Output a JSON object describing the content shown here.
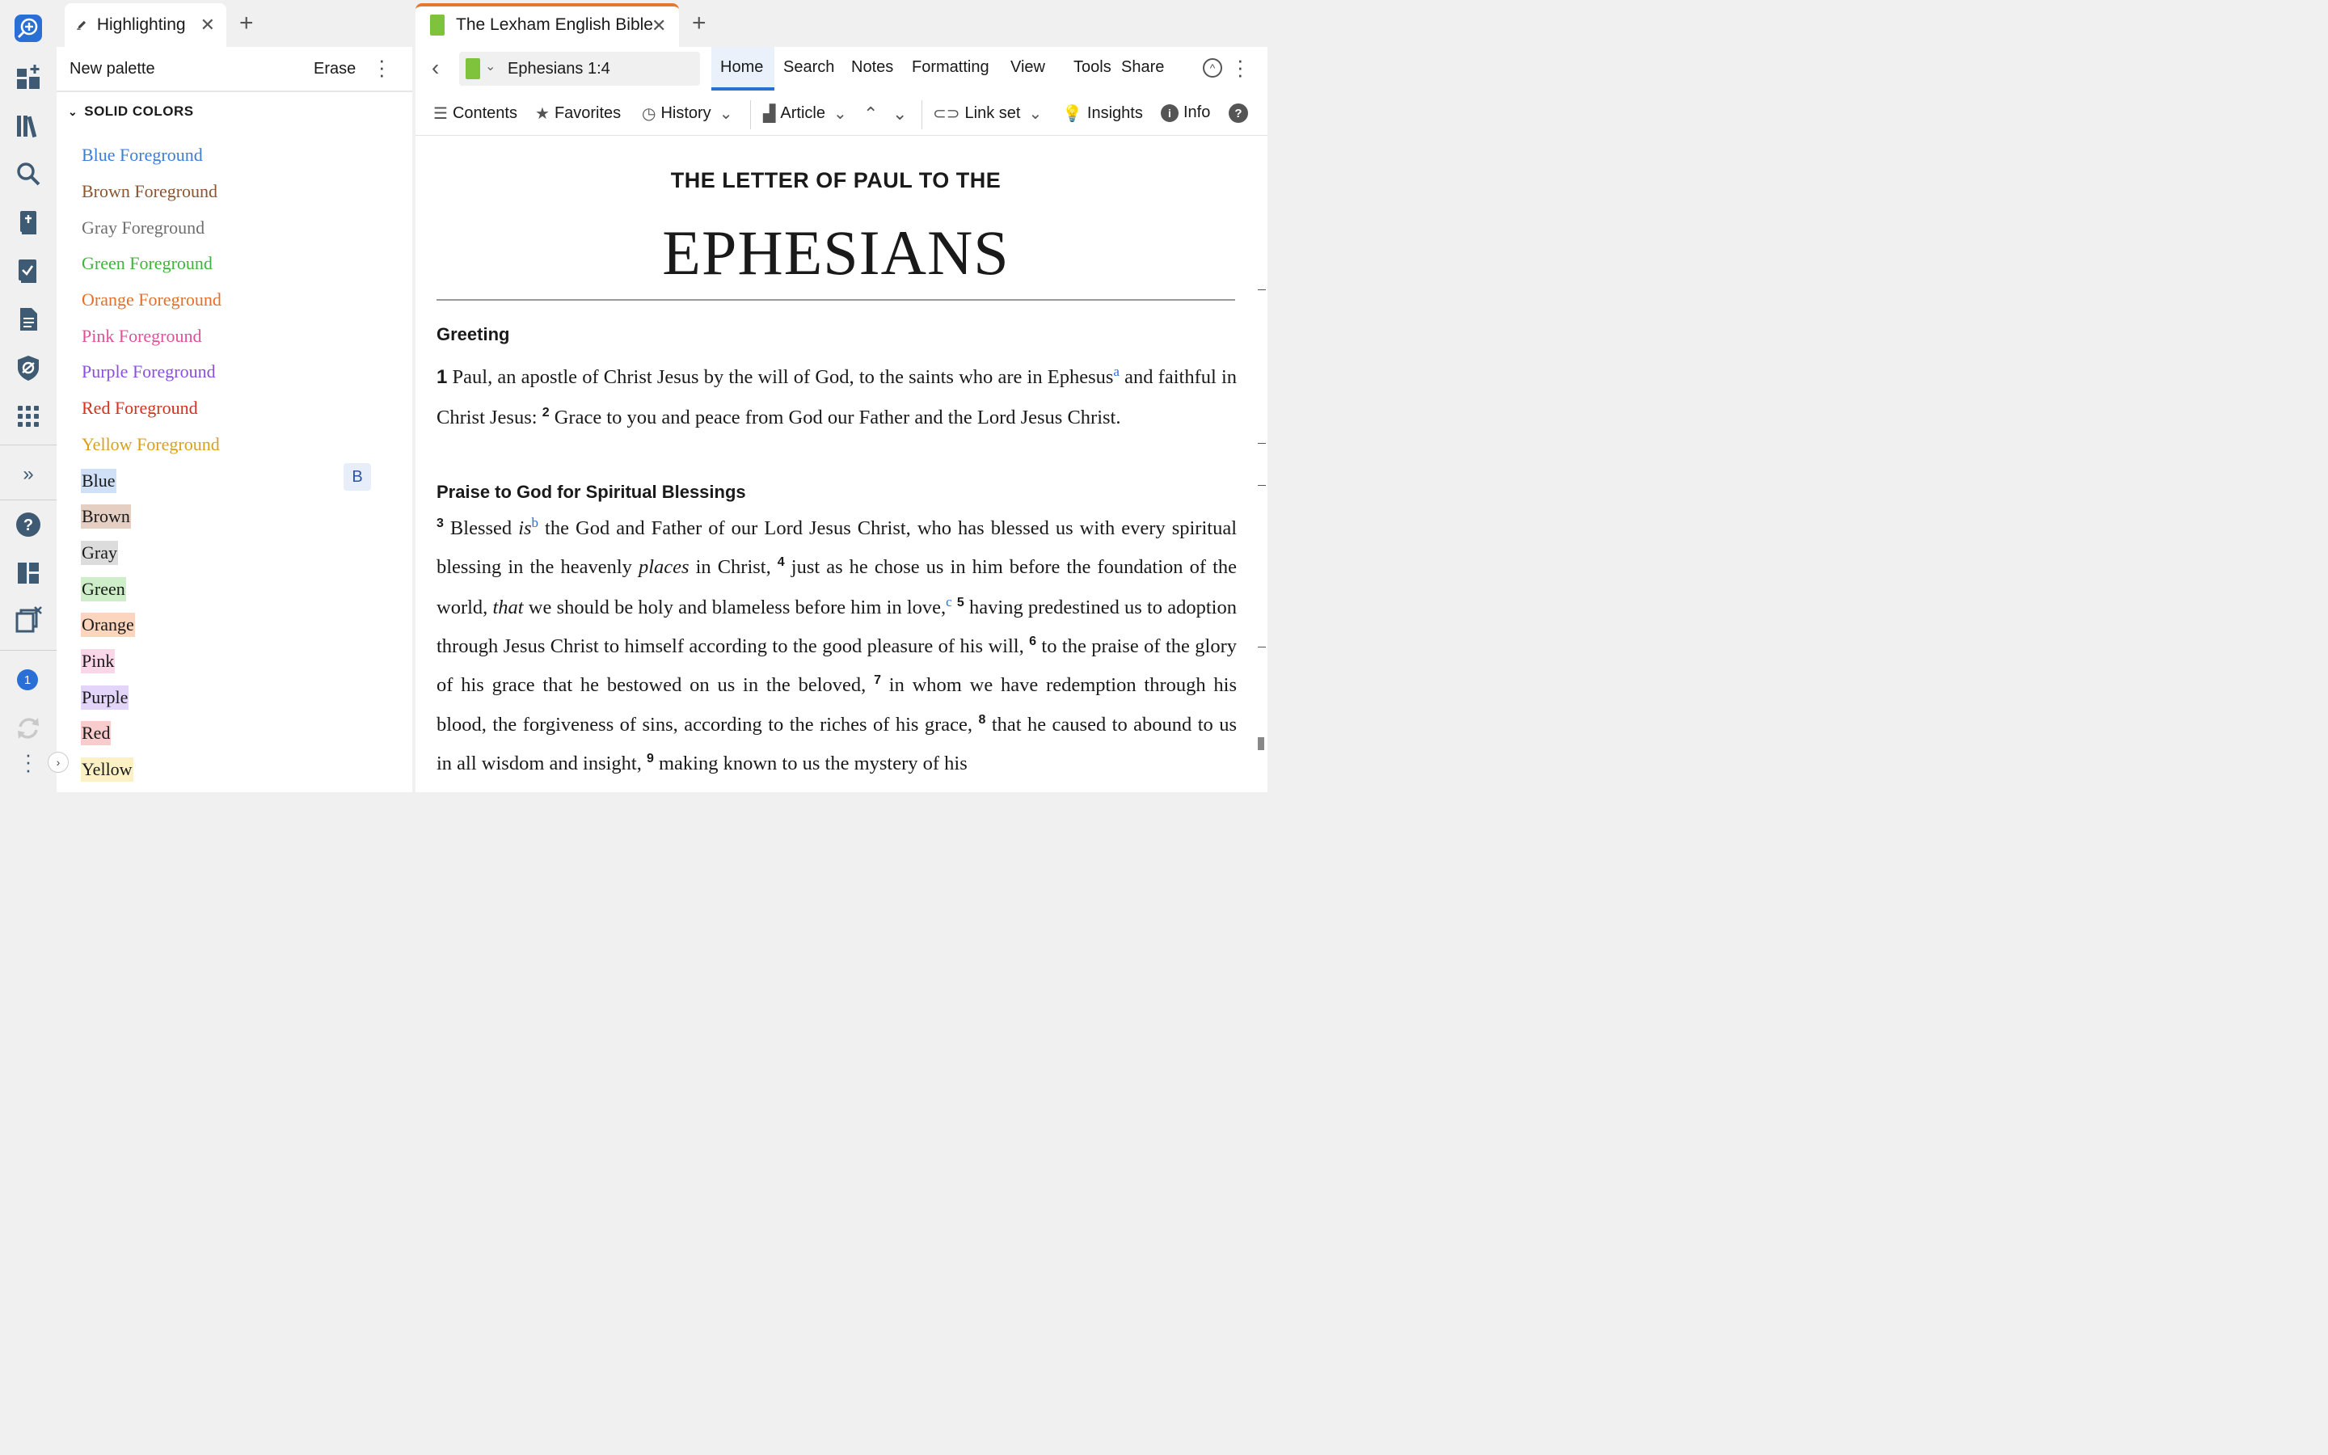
{
  "left_tab": {
    "title": "Highlighting",
    "close": "✕",
    "add": "+"
  },
  "right_tab": {
    "title": "The Lexham English Bible",
    "close": "✕",
    "add": "+"
  },
  "palette": {
    "new_label": "New palette",
    "erase_label": "Erase",
    "section_title": "SOLID COLORS",
    "styles": [
      {
        "label": "Blue Foreground",
        "color": "#3b7dd8",
        "bg": ""
      },
      {
        "label": "Brown Foreground",
        "color": "#8a5530",
        "bg": ""
      },
      {
        "label": "Gray Foreground",
        "color": "#6f6f6f",
        "bg": ""
      },
      {
        "label": "Green Foreground",
        "color": "#3fb43a",
        "bg": ""
      },
      {
        "label": "Orange Foreground",
        "color": "#e2702a",
        "bg": ""
      },
      {
        "label": "Pink Foreground",
        "color": "#e0509a",
        "bg": ""
      },
      {
        "label": "Purple Foreground",
        "color": "#8a4fe0",
        "bg": ""
      },
      {
        "label": "Red Foreground",
        "color": "#d2321e",
        "bg": ""
      },
      {
        "label": "Yellow Foreground",
        "color": "#d9a01c",
        "bg": ""
      },
      {
        "label": "Blue",
        "color": "#1a1a1a",
        "bg": "#cfe0f7"
      },
      {
        "label": "Brown",
        "color": "#1a1a1a",
        "bg": "#e4cfc2"
      },
      {
        "label": "Gray",
        "color": "#1a1a1a",
        "bg": "#dcdcdc"
      },
      {
        "label": "Green",
        "color": "#1a1a1a",
        "bg": "#cdeec9"
      },
      {
        "label": "Orange",
        "color": "#1a1a1a",
        "bg": "#fbd5bd"
      },
      {
        "label": "Pink",
        "color": "#1a1a1a",
        "bg": "#f9d7e8"
      },
      {
        "label": "Purple",
        "color": "#1a1a1a",
        "bg": "#e3d4fa"
      },
      {
        "label": "Red",
        "color": "#1a1a1a",
        "bg": "#f8cccc"
      },
      {
        "label": "Yellow",
        "color": "#1a1a1a",
        "bg": "#fbf1c4"
      }
    ],
    "shortcut_key": "B"
  },
  "nav": {
    "reference": "Ephesians 1:4",
    "menu": [
      "Home",
      "Search",
      "Notes",
      "Formatting",
      "View",
      "Tools",
      "Share"
    ]
  },
  "toolbar": {
    "contents": "Contents",
    "favorites": "Favorites",
    "history": "History",
    "article": "Article",
    "link_set": "Link set",
    "insights": "Insights",
    "info": "Info"
  },
  "rail": {
    "badge_count": "1"
  },
  "document": {
    "pretitle": "THE LETTER OF PAUL TO THE",
    "title": "EPHESIANS",
    "heading1": "Greeting",
    "heading2": "Praise to God for Spiritual Blessings",
    "v1_num": "1",
    "v1_text": " Paul, an apostle of Christ Jesus by the will of God, to the saints who are in Ephesus",
    "fn_a": "a",
    "v1_text2": " and faithful in Christ Jesus: ",
    "v2_num": "2",
    "v2_text": " Grace to you and peace from God our Father and the Lord Jesus Christ.",
    "v3_num": "3",
    "v3_text_a": " Blessed ",
    "v3_is": "is",
    "fn_b": "b",
    "v3_text_b": " the God and Father of our Lord Jesus Christ, who has blessed us with every spiritual blessing in the heavenly ",
    "v3_places": "places",
    "v3_text_c": " in Christ, ",
    "v4_num": "4",
    "v4_text_a": " just as he chose us in him before the foundation of the world, ",
    "v4_that": "that",
    "v4_text_b": " we should be holy and blameless before him in love,",
    "fn_c": "c",
    "v5_num": "5",
    "v5_text": " having predestined us to adoption through Jesus Christ to himself according to the good pleasure of his will, ",
    "v6_num": "6",
    "v6_text": " to the praise of the glory of his grace that he bestowed on us in the beloved, ",
    "v7_num": "7",
    "v7_text": " in whom we have redemption through his blood, the forgiveness of sins, according to the riches of his grace, ",
    "v8_num": "8",
    "v8_text": " that he caused to abound to us in all wisdom and insight, ",
    "v9_num": "9",
    "v9_text": " making known to us the mystery of his"
  }
}
